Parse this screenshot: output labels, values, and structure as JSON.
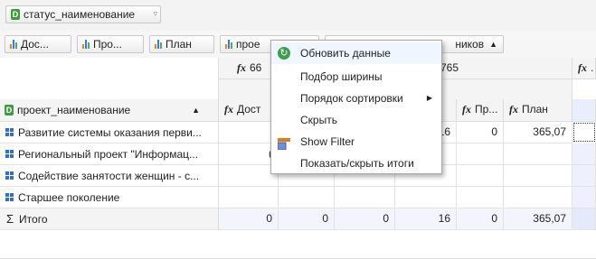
{
  "filter_bar": {
    "status_field": "статус_наименование"
  },
  "column_fields": [
    {
      "label": "Дос..."
    },
    {
      "label": "Про..."
    },
    {
      "label": "План"
    },
    {
      "label": "прое"
    },
    {
      "label": "ников"
    }
  ],
  "column_header": {
    "group1_code": "66",
    "group2_code": "765",
    "last_partial": ".",
    "measures": [
      {
        "label": "Дост"
      },
      {
        "label": "Пр..."
      },
      {
        "label": "План"
      }
    ]
  },
  "row_field": {
    "label": "проект_наименование"
  },
  "rows": [
    {
      "label": "Развитие системы оказания перви...",
      "values": [
        "",
        "",
        "",
        "16",
        "0",
        "365,07"
      ]
    },
    {
      "label": "Региональный проект \"Информац...",
      "values": [
        "(",
        "",
        "",
        "",
        "",
        ""
      ]
    },
    {
      "label": "Содействие занятости женщин - с...",
      "values": [
        "",
        "",
        "",
        "",
        "",
        ""
      ]
    },
    {
      "label": "Старшее поколение",
      "values": [
        "",
        "",
        "",
        "",
        "",
        ""
      ]
    }
  ],
  "totals": {
    "symbol": "Σ",
    "label": "Итого",
    "values": [
      "0",
      "0",
      "0",
      "16",
      "0",
      "365,07"
    ]
  },
  "context_menu": {
    "items": [
      {
        "label": "Обновить данные",
        "icon": "refresh-icon"
      },
      {
        "label": "Подбор ширины"
      },
      {
        "label": "Порядок сортировки",
        "submenu": true
      },
      {
        "label": "Скрыть"
      },
      {
        "label": "Show Filter",
        "icon": "filter-icon"
      },
      {
        "label": "Показать/скрыть итоги"
      }
    ]
  }
}
